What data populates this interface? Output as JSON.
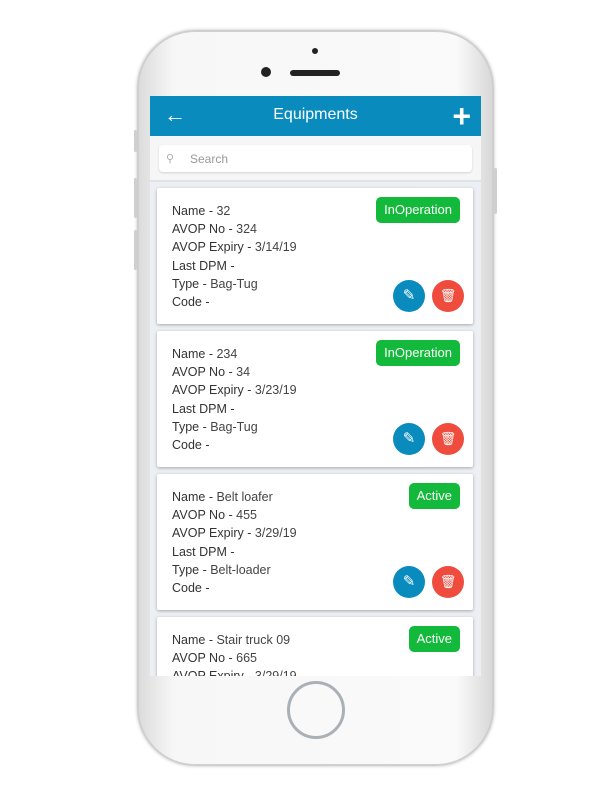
{
  "header": {
    "title": "Equipments",
    "back_icon": "arrow-left-icon",
    "add_icon": "plus-icon"
  },
  "search": {
    "placeholder": "Search",
    "value": ""
  },
  "labels": {
    "name": "Name",
    "avop_no": "AVOP No",
    "avop_expiry": "AVOP Expiry",
    "last_dpm": "Last DPM",
    "type": "Type",
    "code": "Code"
  },
  "colors": {
    "header": "#0a8bbd",
    "status": "#12b93a",
    "edit": "#0a8bbd",
    "delete": "#ef4c3d"
  },
  "items": [
    {
      "name": "32",
      "avop_no": "324",
      "avop_expiry": "3/14/19",
      "last_dpm": "",
      "type": "Bag-Tug",
      "code": "",
      "status": "InOperation"
    },
    {
      "name": "234",
      "avop_no": "34",
      "avop_expiry": "3/23/19",
      "last_dpm": "",
      "type": "Bag-Tug",
      "code": "",
      "status": "InOperation"
    },
    {
      "name": "Belt loafer",
      "avop_no": "455",
      "avop_expiry": "3/29/19",
      "last_dpm": "",
      "type": "Belt-loader",
      "code": "",
      "status": "Active"
    },
    {
      "name": "Stair truck 09",
      "avop_no": "665",
      "avop_expiry": "3/29/19",
      "last_dpm": "",
      "type": "",
      "code": "",
      "status": "Active"
    }
  ]
}
